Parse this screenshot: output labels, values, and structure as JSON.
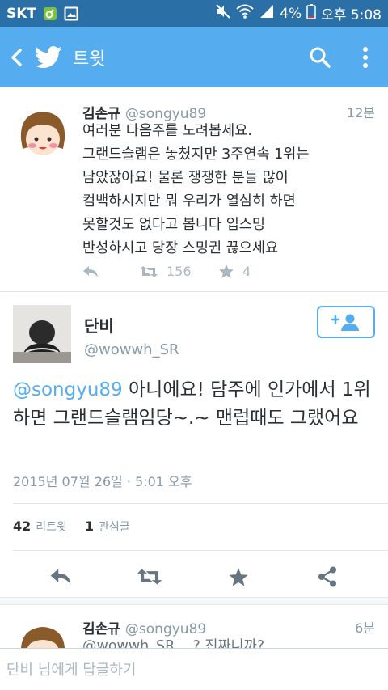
{
  "status_bar": {
    "carrier": "SKT",
    "battery": "4%",
    "time": "오후 5:08"
  },
  "app_bar": {
    "title": "트윗",
    "brand_color": "#55acee"
  },
  "previous_tweet": {
    "name": "김손규",
    "handle": "@songyu89",
    "time": "12분",
    "lines": [
      "여러분 다음주를 노려봅세요.",
      "그랜드슬램은 놓쳤지만 3주연속 1위는",
      "남았잖아요! 물론 쟁쟁한 분들 많이",
      "컴백하시지만 뭐 우리가 열심히 하면",
      "못할것도 없다고 봅니다 입스밍",
      "반성하시고 당장 스밍권 끊으세요"
    ],
    "retweets": "156",
    "favorites": "4"
  },
  "main_tweet": {
    "name": "단비",
    "handle": "@wowwh_SR",
    "mention": "@songyu89",
    "text_after_mention": " 아니에요! 담주에 인가에서 1위하면 그랜드슬램임당~.~ 맨럽때도 그랬어요",
    "date": "2015년 07월 26일 · 5:01 오후",
    "retweet_count": "42",
    "retweet_label": "리트윗",
    "favorite_count": "1",
    "favorite_label": "관심글"
  },
  "next_tweet": {
    "name": "김손규",
    "handle": "@songyu89",
    "time": "6분",
    "text": "@wowwh_SR ...? 진짜니까?"
  },
  "reply": {
    "placeholder": "단비 님에게 답글하기"
  },
  "icons": [
    "back-icon",
    "twitter-bird-icon",
    "search-icon",
    "overflow-menu-icon",
    "reply-icon",
    "retweet-icon",
    "favorite-icon",
    "share-icon",
    "follow-icon"
  ]
}
